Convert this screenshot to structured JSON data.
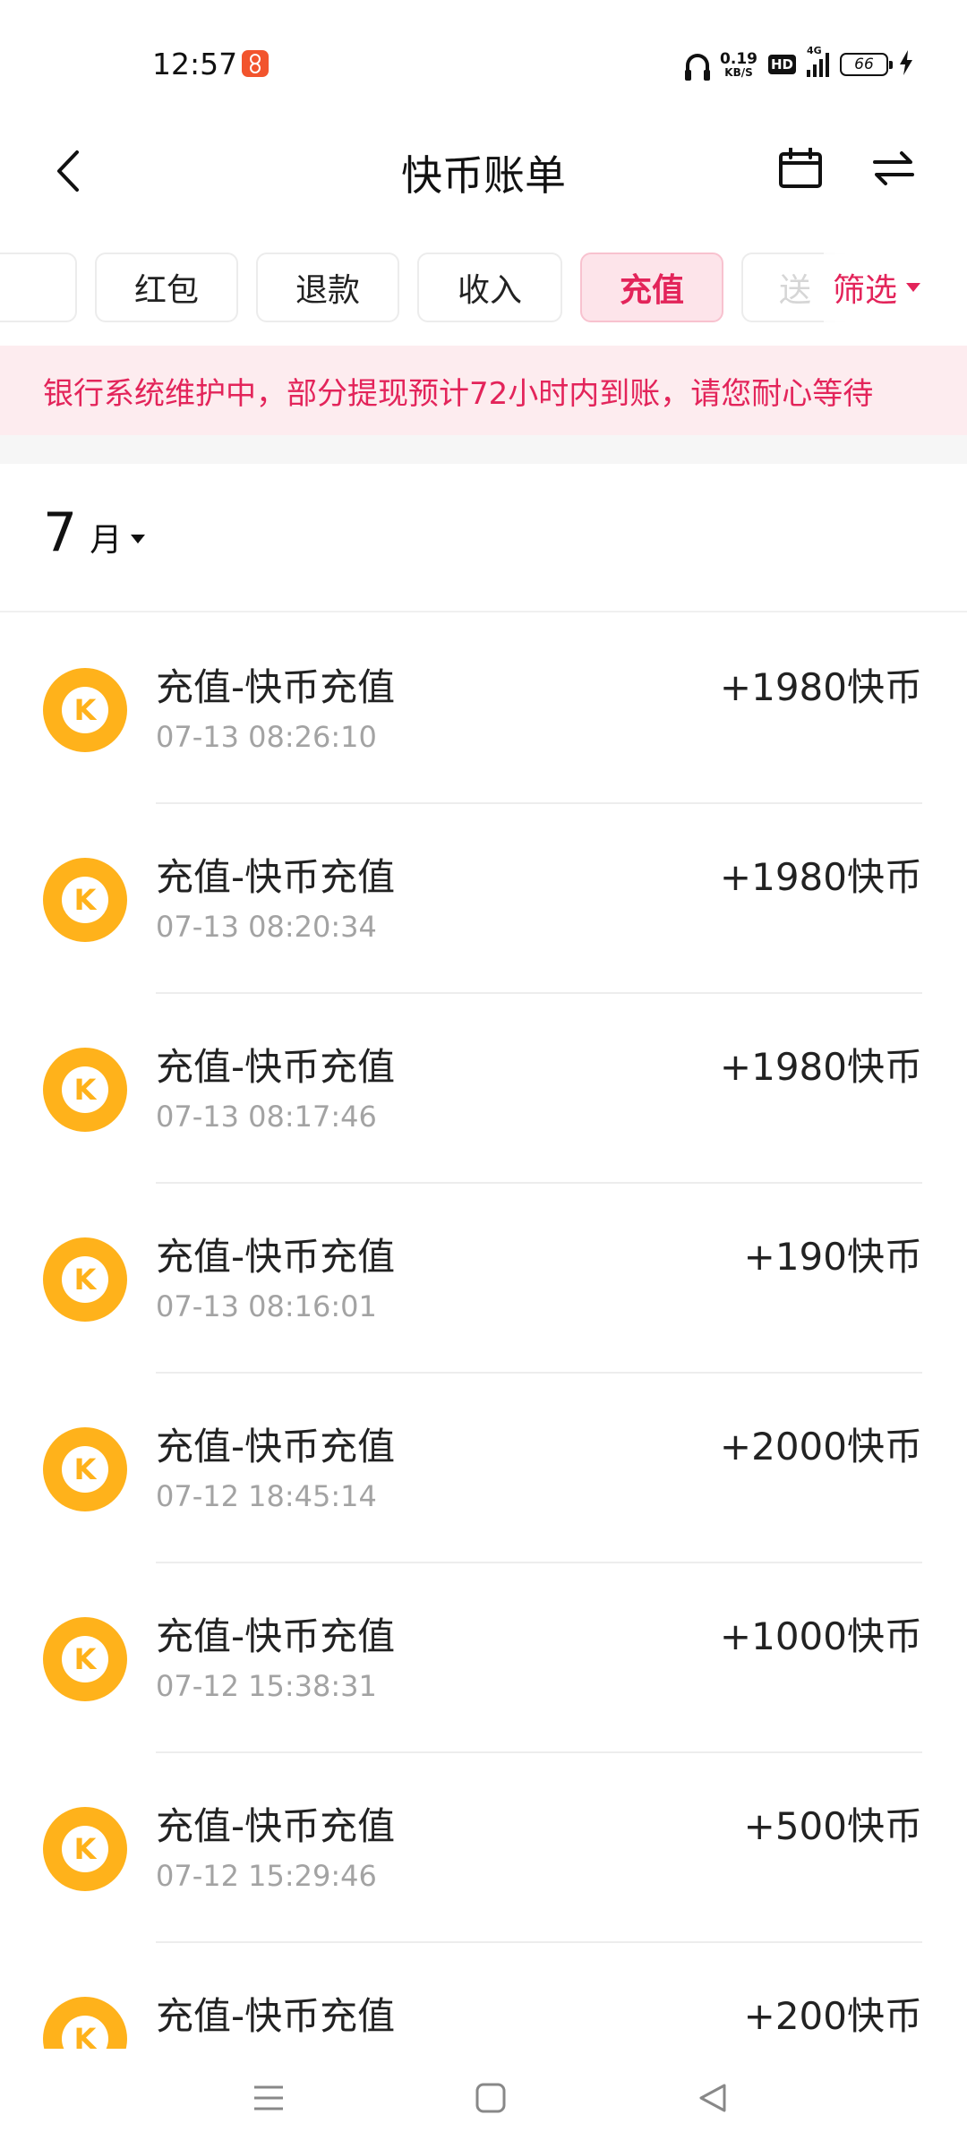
{
  "status_bar": {
    "time": "12:57",
    "net_speed_value": "0.19",
    "net_speed_unit": "KB/S",
    "hd_label": "HD",
    "network_label": "4G",
    "battery_level": "66"
  },
  "header": {
    "title": "快币账单"
  },
  "tabs": [
    {
      "label": ""
    },
    {
      "label": "红包"
    },
    {
      "label": "退款"
    },
    {
      "label": "收入"
    },
    {
      "label": "充值",
      "active": true
    },
    {
      "label": "送"
    }
  ],
  "filter": {
    "label": "筛选"
  },
  "notice": {
    "text": "银行系统维护中，部分提现预计72小时内到账，请您耐心等待"
  },
  "month": {
    "number": "7",
    "unit": "月"
  },
  "records": [
    {
      "icon_letter": "K",
      "title": "充值-快币充值",
      "time": "07-13 08:26:10",
      "amount": "+1980快币"
    },
    {
      "icon_letter": "K",
      "title": "充值-快币充值",
      "time": "07-13 08:20:34",
      "amount": "+1980快币"
    },
    {
      "icon_letter": "K",
      "title": "充值-快币充值",
      "time": "07-13 08:17:46",
      "amount": "+1980快币"
    },
    {
      "icon_letter": "K",
      "title": "充值-快币充值",
      "time": "07-13 08:16:01",
      "amount": "+190快币"
    },
    {
      "icon_letter": "K",
      "title": "充值-快币充值",
      "time": "07-12 18:45:14",
      "amount": "+2000快币"
    },
    {
      "icon_letter": "K",
      "title": "充值-快币充值",
      "time": "07-12 15:38:31",
      "amount": "+1000快币"
    },
    {
      "icon_letter": "K",
      "title": "充值-快币充值",
      "time": "07-12 15:29:46",
      "amount": "+500快币"
    },
    {
      "icon_letter": "K",
      "title": "充值-快币充值",
      "time": "",
      "amount": "+200快币"
    }
  ],
  "colors": {
    "accent": "#e3245a",
    "notice_bg": "#fdecef",
    "coin": "#ffb21b",
    "secondary_text": "#a3a3a3"
  },
  "icons": {
    "back": "chevron-left-icon",
    "calendar": "calendar-icon",
    "switch": "swap-arrows-icon",
    "coin": "kuaibi-coin-icon",
    "nav_menu": "menu-icon",
    "nav_home": "home-square-icon",
    "nav_back": "triangle-back-icon"
  }
}
